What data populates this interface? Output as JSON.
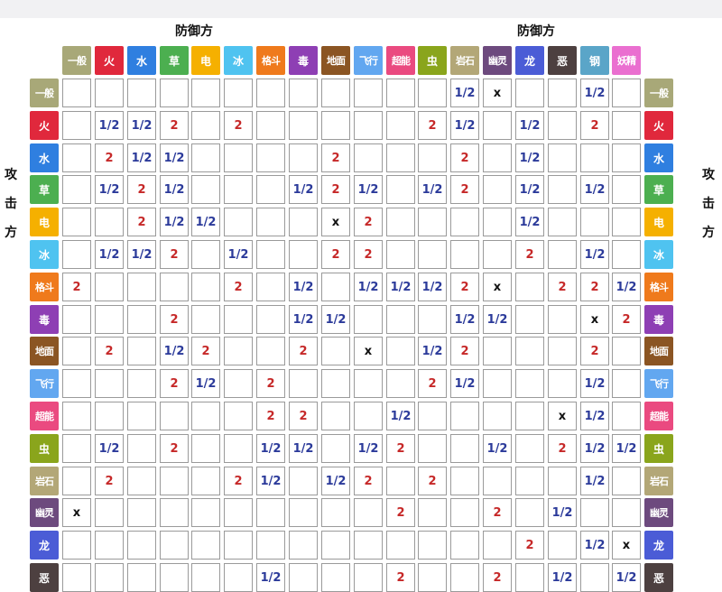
{
  "titles": {
    "defender_left": "防御方",
    "defender_right": "防御方",
    "attacker": [
      "攻",
      "击",
      "方"
    ]
  },
  "types": [
    {
      "name": "一般",
      "color": "#a8a878"
    },
    {
      "name": "火",
      "color": "#e0283c"
    },
    {
      "name": "水",
      "color": "#2f7fe0"
    },
    {
      "name": "草",
      "color": "#4caf50"
    },
    {
      "name": "电",
      "color": "#f5b000"
    },
    {
      "name": "冰",
      "color": "#4fc3f0"
    },
    {
      "name": "格斗",
      "color": "#ef7a1c"
    },
    {
      "name": "毒",
      "color": "#8e3fb4"
    },
    {
      "name": "地面",
      "color": "#8b5523"
    },
    {
      "name": "飞行",
      "color": "#62a7f0"
    },
    {
      "name": "超能",
      "color": "#ea4a80"
    },
    {
      "name": "虫",
      "color": "#8aa51c"
    },
    {
      "name": "岩石",
      "color": "#b3a777"
    },
    {
      "name": "幽灵",
      "color": "#6d4a7e"
    },
    {
      "name": "龙",
      "color": "#4b5cd6"
    },
    {
      "name": "恶",
      "color": "#4d4040"
    },
    {
      "name": "钢",
      "color": "#5aa5c8"
    },
    {
      "name": "妖精",
      "color": "#ea6fd0"
    }
  ],
  "matrix": [
    [
      "",
      "",
      "",
      "",
      "",
      "",
      "",
      "",
      "",
      "",
      "",
      "",
      "1/2",
      "x",
      "",
      "",
      "1/2",
      ""
    ],
    [
      "",
      "1/2",
      "1/2",
      "2",
      "",
      "2",
      "",
      "",
      "",
      "",
      "",
      "2",
      "1/2",
      "",
      "1/2",
      "",
      "2",
      ""
    ],
    [
      "",
      "2",
      "1/2",
      "1/2",
      "",
      "",
      "",
      "",
      "2",
      "",
      "",
      "",
      "2",
      "",
      "1/2",
      "",
      "",
      ""
    ],
    [
      "",
      "1/2",
      "2",
      "1/2",
      "",
      "",
      "",
      "1/2",
      "2",
      "1/2",
      "",
      "1/2",
      "2",
      "",
      "1/2",
      "",
      "1/2",
      ""
    ],
    [
      "",
      "",
      "2",
      "1/2",
      "1/2",
      "",
      "",
      "",
      "x",
      "2",
      "",
      "",
      "",
      "",
      "1/2",
      "",
      "",
      ""
    ],
    [
      "",
      "1/2",
      "1/2",
      "2",
      "",
      "1/2",
      "",
      "",
      "2",
      "2",
      "",
      "",
      "",
      "",
      "2",
      "",
      "1/2",
      ""
    ],
    [
      "2",
      "",
      "",
      "",
      "",
      "2",
      "",
      "1/2",
      "",
      "1/2",
      "1/2",
      "1/2",
      "2",
      "x",
      "",
      "2",
      "2",
      "1/2"
    ],
    [
      "",
      "",
      "",
      "2",
      "",
      "",
      "",
      "1/2",
      "1/2",
      "",
      "",
      "",
      "1/2",
      "1/2",
      "",
      "",
      "x",
      "2"
    ],
    [
      "",
      "2",
      "",
      "1/2",
      "2",
      "",
      "",
      "2",
      "",
      "x",
      "",
      "1/2",
      "2",
      "",
      "",
      "",
      "2",
      ""
    ],
    [
      "",
      "",
      "",
      "2",
      "1/2",
      "",
      "2",
      "",
      "",
      "",
      "",
      "2",
      "1/2",
      "",
      "",
      "",
      "1/2",
      ""
    ],
    [
      "",
      "",
      "",
      "",
      "",
      "",
      "2",
      "2",
      "",
      "",
      "1/2",
      "",
      "",
      "",
      "",
      "x",
      "1/2",
      ""
    ],
    [
      "",
      "1/2",
      "",
      "2",
      "",
      "",
      "1/2",
      "1/2",
      "",
      "1/2",
      "2",
      "",
      "",
      "1/2",
      "",
      "2",
      "1/2",
      "1/2"
    ],
    [
      "",
      "2",
      "",
      "",
      "",
      "2",
      "1/2",
      "",
      "1/2",
      "2",
      "",
      "2",
      "",
      "",
      "",
      "",
      "1/2",
      ""
    ],
    [
      "x",
      "",
      "",
      "",
      "",
      "",
      "",
      "",
      "",
      "",
      "2",
      "",
      "",
      "2",
      "",
      "1/2",
      "",
      ""
    ],
    [
      "",
      "",
      "",
      "",
      "",
      "",
      "",
      "",
      "",
      "",
      "",
      "",
      "",
      "",
      "2",
      "",
      "1/2",
      "x"
    ],
    [
      "",
      "",
      "",
      "",
      "",
      "",
      "1/2",
      "",
      "",
      "",
      "2",
      "",
      "",
      "2",
      "",
      "1/2",
      "",
      "1/2"
    ]
  ]
}
